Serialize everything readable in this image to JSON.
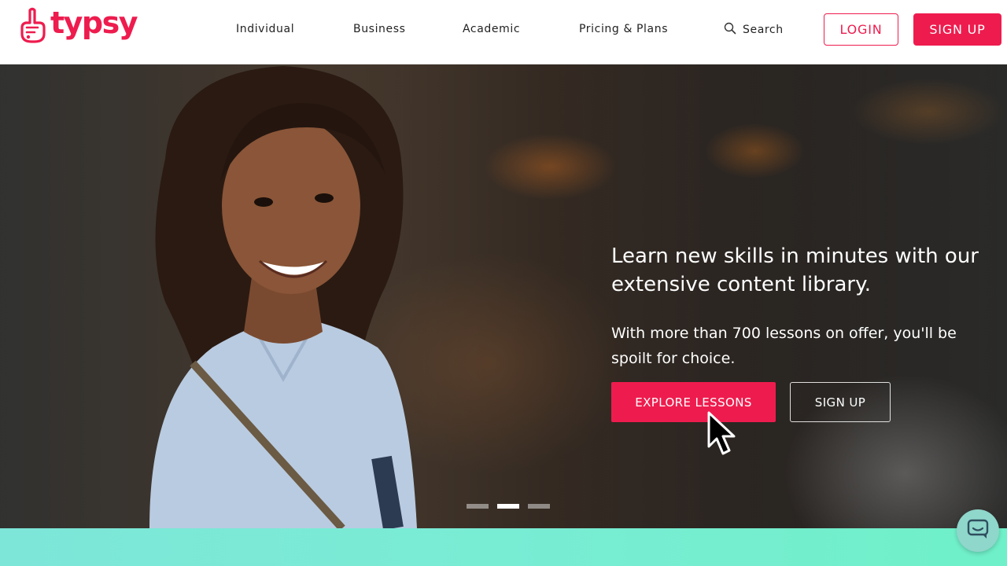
{
  "brand": {
    "name": "typsy",
    "color": "#ee1c4e"
  },
  "nav": {
    "items": [
      {
        "label": "Individual"
      },
      {
        "label": "Business"
      },
      {
        "label": "Academic"
      },
      {
        "label": "Pricing & Plans"
      }
    ],
    "search_label": "Search",
    "login_label": "LOGIN",
    "signup_label": "SIGN UP"
  },
  "hero": {
    "title": "Learn new skills in minutes with our extensive content library.",
    "subtitle": "With more than 700 lessons on offer, you'll be spoilt for choice.",
    "explore_label": "EXPLORE LESSONS",
    "signup_label": "SIGN UP",
    "slides": {
      "count": 3,
      "active": 2
    }
  },
  "icons": {
    "logo": "hand-logo-icon",
    "search": "search-icon",
    "chat": "chat-icon",
    "cursor": "mouse-pointer-icon"
  },
  "colors": {
    "accent": "#ee1c4e",
    "strip": "#79ecd4",
    "chat": "#8fd6cb"
  }
}
